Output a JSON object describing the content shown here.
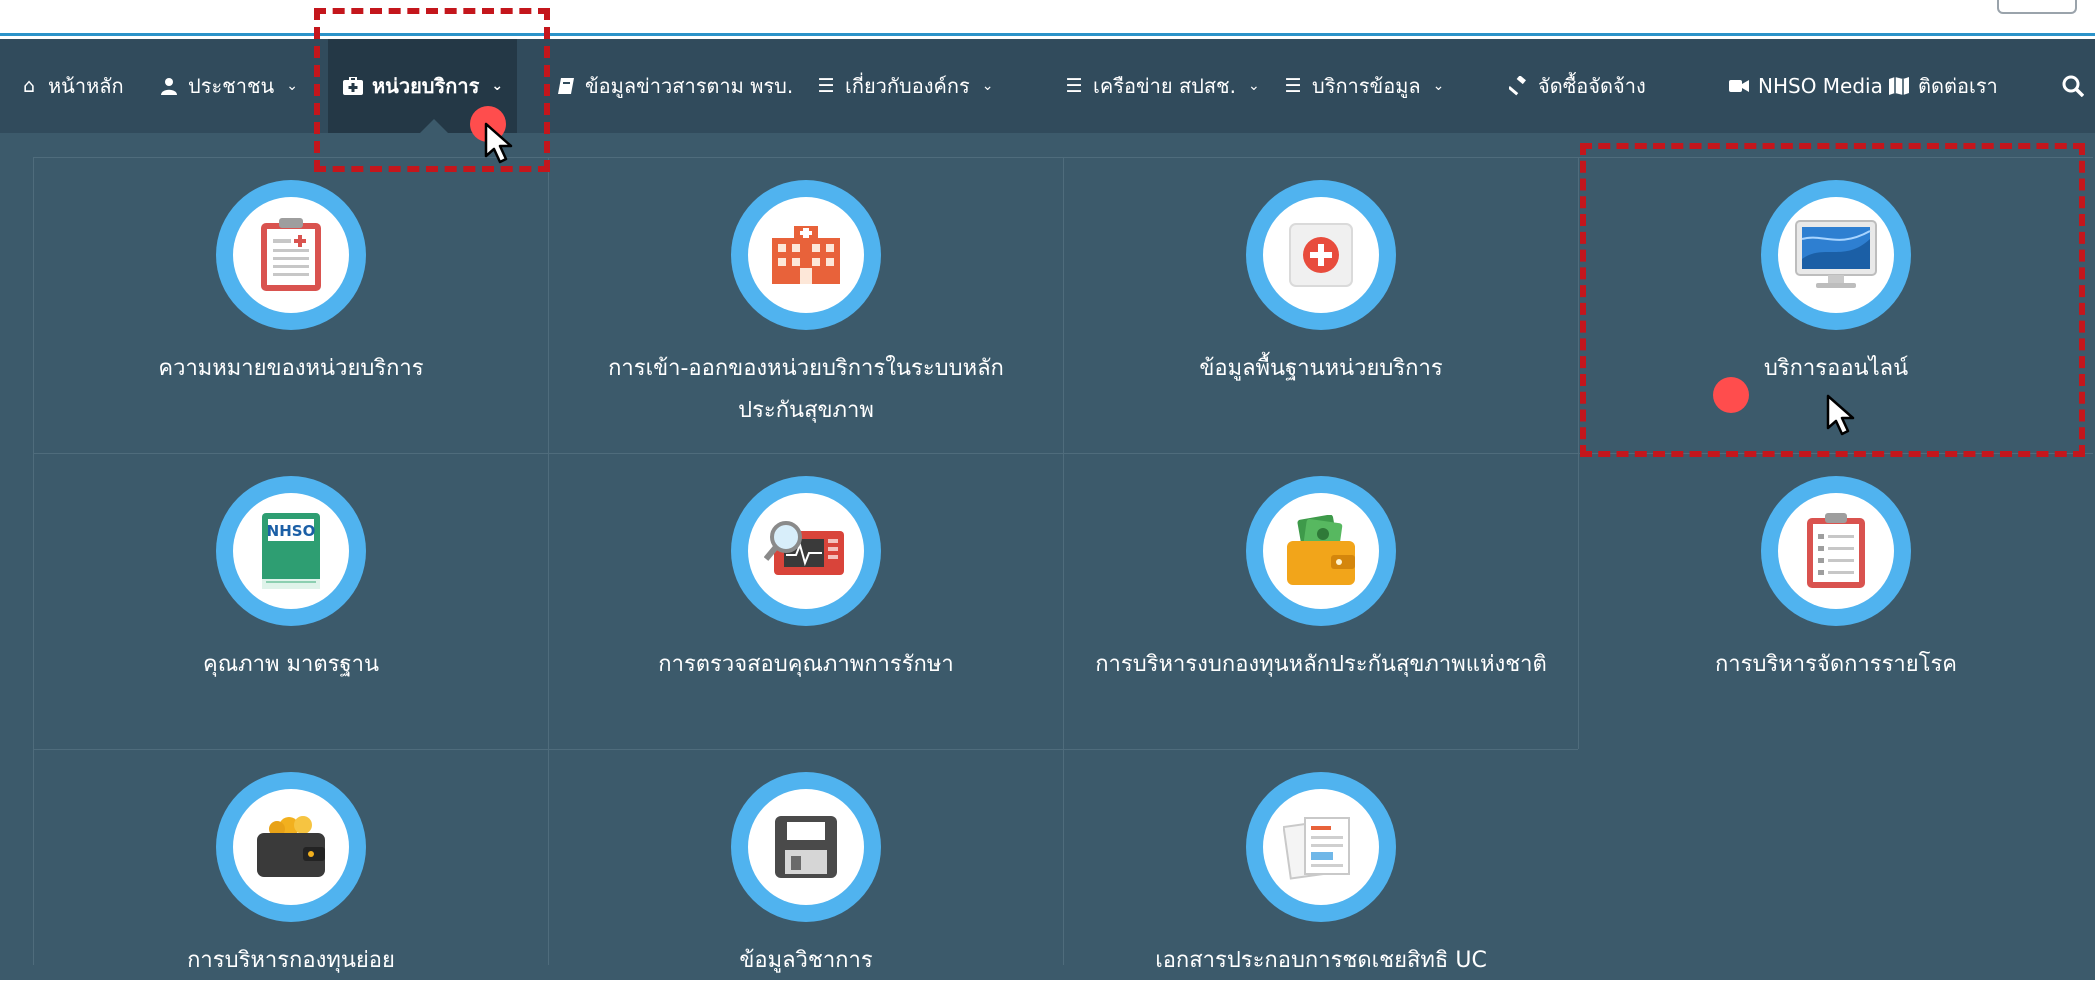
{
  "navbar": {
    "items": [
      {
        "label": "หน้าหลัก",
        "icon": "home-icon",
        "chevron": false
      },
      {
        "label": "ประชาชน",
        "icon": "user-icon",
        "chevron": true
      },
      {
        "label": "หน่วยบริการ",
        "icon": "medkit-icon",
        "chevron": true,
        "active": true
      },
      {
        "label": "ข้อมูลข่าวสารตาม พรบ.",
        "icon": "book-icon",
        "chevron": false
      },
      {
        "label": "เกี่ยวกับองค์กร",
        "icon": "list-icon",
        "chevron": true
      },
      {
        "label": "เครือข่าย สปสช.",
        "icon": "list-icon",
        "chevron": true
      },
      {
        "label": "บริการข้อมูล",
        "icon": "list-icon",
        "chevron": true
      },
      {
        "label": "จัดซื้อจัดจ้าง",
        "icon": "gavel-icon",
        "chevron": false
      },
      {
        "label": "NHSO Media",
        "icon": "video-icon",
        "chevron": false
      },
      {
        "label": "ติดต่อเรา",
        "icon": "map-icon",
        "chevron": false
      }
    ],
    "chevron_glyph": "⌄"
  },
  "menu": {
    "cards": [
      {
        "title": "ความหมายของหน่วยบริการ",
        "icon": "clipboard-medical-icon"
      },
      {
        "title": "การเข้า-ออกของหน่วยบริการในระบบหลักประกันสุขภาพ",
        "icon": "hospital-building-icon"
      },
      {
        "title": "ข้อมูลพื้นฐานหน่วยบริการ",
        "icon": "first-aid-icon"
      },
      {
        "title": "บริการออนไลน์",
        "icon": "computer-monitor-icon"
      },
      {
        "title": "คุณภาพ มาตรฐาน",
        "icon": "nhso-book-icon",
        "icon_text": "NHSO"
      },
      {
        "title": "การตรวจสอบคุณภาพการรักษา",
        "icon": "medical-monitor-inspect-icon"
      },
      {
        "title": "การบริหารงบกองทุนหลักประกันสุขภาพแห่งชาติ",
        "icon": "wallet-money-icon"
      },
      {
        "title": "การบริหารจัดการรายโรค",
        "icon": "checklist-icon"
      },
      {
        "title": "การบริหารกองทุนย่อย",
        "icon": "coin-wallet-icon"
      },
      {
        "title": "ข้อมูลวิชาการ",
        "icon": "floppy-disk-icon"
      },
      {
        "title": "เอกสารประกอบการชดเชยสิทธิ UC",
        "icon": "documents-icon"
      }
    ]
  },
  "colors": {
    "navbar_bg": "#314b5c",
    "panel_bg": "#3c5a6b",
    "icon_ring": "#50b3ef",
    "highlight": "#c4161c",
    "cursor_dot": "#ff4d4d"
  }
}
